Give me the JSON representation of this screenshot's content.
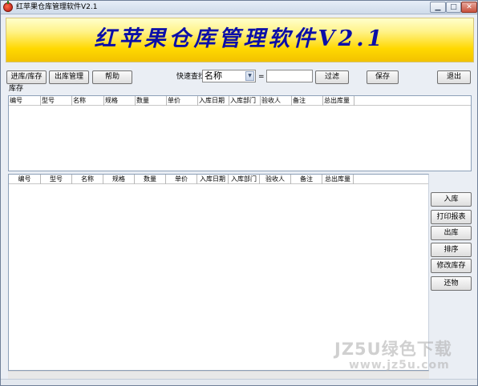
{
  "window": {
    "title": "红苹果仓库管理软件V2.1",
    "controls": {
      "minimize": "▁",
      "maximize": "□",
      "close": "✕"
    }
  },
  "banner": {
    "title": "红苹果仓库管理软件V2.1"
  },
  "toolbar": {
    "stock_in_button": "进库/库存",
    "stock_out_button": "出库管理",
    "help_button": "帮助",
    "quick_search_label": "快速查找",
    "search_field_selected": "名称",
    "equals_label": "=",
    "search_value": "",
    "filter_button": "过滤",
    "save_button": "保存",
    "exit_button": "退出"
  },
  "inventory_group": {
    "label": "库存"
  },
  "inventory_table": {
    "columns": [
      "编号",
      "型号",
      "名称",
      "规格",
      "数量",
      "单价",
      "入库日期",
      "入库部门",
      "验收人",
      "备注",
      "总出库量"
    ],
    "rows": []
  },
  "detail_table": {
    "columns": [
      "编号",
      "型号",
      "名称",
      "规格",
      "数量",
      "单价",
      "入库日期",
      "入库部门",
      "验收人",
      "备注",
      "总出库量"
    ],
    "rows": []
  },
  "side_actions": {
    "stock_in": "入库",
    "print_report": "打印报表",
    "stock_out": "出库",
    "sort": "排序",
    "edit_stock": "修改库存",
    "return_goods": "还物"
  },
  "watermark": {
    "line1": "JZ5U绿色下载",
    "line2": "www.jz5u.com"
  }
}
